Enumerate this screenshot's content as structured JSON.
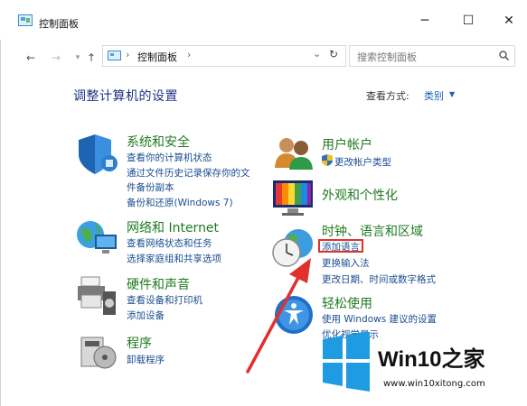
{
  "window": {
    "title": "控制面板"
  },
  "address": {
    "path": "控制面板"
  },
  "search": {
    "placeholder": "搜索控制面板"
  },
  "main": {
    "title": "调整计算机的设置",
    "view_by_label": "查看方式:",
    "view_by_value": "类别"
  },
  "categories": [
    {
      "title": "系统和安全",
      "links": [
        "查看你的计算机状态",
        "通过文件历史记录保存你的文",
        "件备份副本",
        "备份和还原(Windows 7)"
      ]
    },
    {
      "title": "网络和 Internet",
      "links": [
        "查看网络状态和任务",
        "选择家庭组和共享选项"
      ]
    },
    {
      "title": "硬件和声音",
      "links": [
        "查看设备和打印机",
        "添加设备"
      ]
    },
    {
      "title": "程序",
      "links": [
        "卸载程序"
      ]
    },
    {
      "title": "用户帐户",
      "links": [
        "更改帐户类型"
      ]
    },
    {
      "title": "外观和个性化",
      "links": []
    },
    {
      "title": "时钟、语言和区域",
      "links": [
        "添加语言",
        "更换输入法",
        "更改日期、时间或数字格式"
      ]
    },
    {
      "title": "轻松使用",
      "links": [
        "使用 Windows 建议的设置",
        "优化视觉显示"
      ]
    }
  ],
  "watermark": {
    "title": "Win10之家",
    "url": "www.win10xitong.com"
  },
  "colors": {
    "link": "#1a4d8f",
    "category_title": "#1f7a1f",
    "highlight": "#e0312e",
    "arrow": "#e0312e",
    "win_logo": "#1e9be3"
  }
}
